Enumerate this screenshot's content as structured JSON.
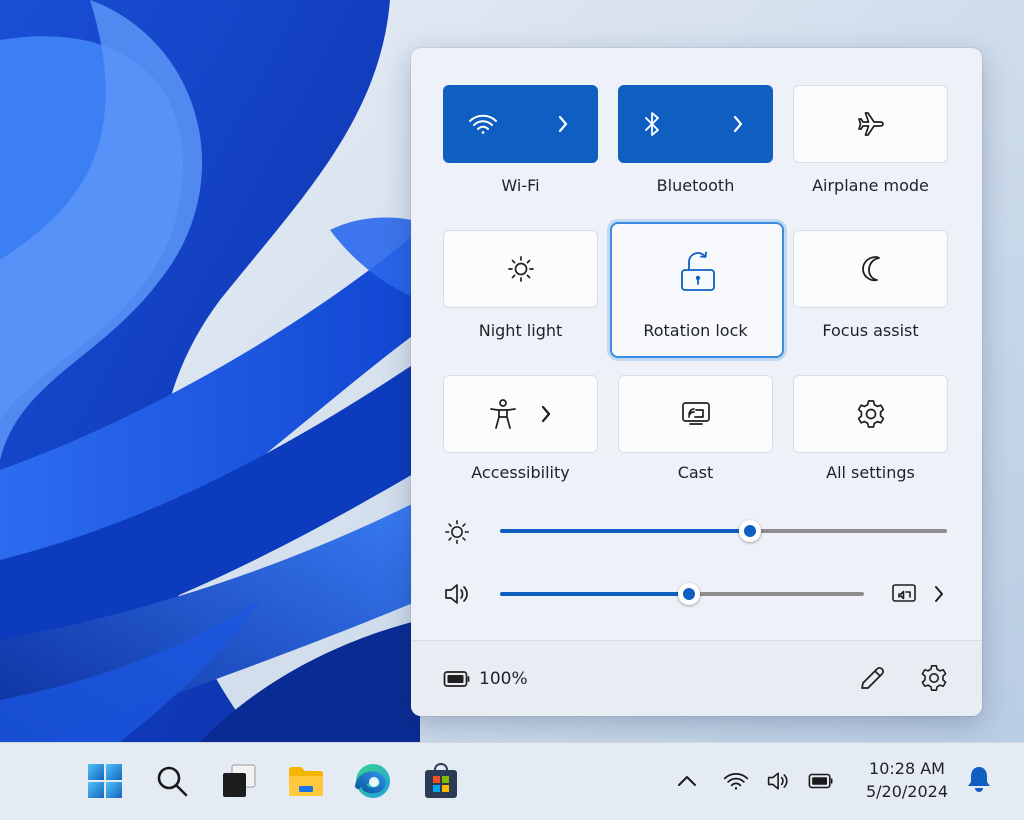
{
  "quick_settings": {
    "tiles": [
      {
        "label": "Wi-Fi",
        "icon": "wifi-icon",
        "state": "on",
        "has_chevron": true
      },
      {
        "label": "Bluetooth",
        "icon": "bluetooth-icon",
        "state": "on",
        "has_chevron": true
      },
      {
        "label": "Airplane mode",
        "icon": "airplane-icon",
        "state": "off",
        "has_chevron": false
      },
      {
        "label": "Night light",
        "icon": "sun-icon",
        "state": "off",
        "has_chevron": false
      },
      {
        "label": "Rotation lock",
        "icon": "unlocked-rotate-icon",
        "state": "focused",
        "has_chevron": false
      },
      {
        "label": "Focus assist",
        "icon": "moon-icon",
        "state": "off",
        "has_chevron": false
      },
      {
        "label": "Accessibility",
        "icon": "accessibility-icon",
        "state": "off",
        "has_chevron": true
      },
      {
        "label": "Cast",
        "icon": "cast-icon",
        "state": "off",
        "has_chevron": false
      },
      {
        "label": "All settings",
        "icon": "gear-icon",
        "state": "off",
        "has_chevron": false
      }
    ],
    "brightness": {
      "icon": "brightness-icon",
      "level": 0.56
    },
    "volume": {
      "icon": "speaker-icon",
      "level": 0.52,
      "output_icon": "audio-output-icon"
    },
    "battery": {
      "icon": "battery-icon",
      "text": "100%"
    },
    "footer_actions": [
      "edit-pencil-icon",
      "settings-gear-icon"
    ]
  },
  "taskbar": {
    "apps": [
      "windows-start-icon",
      "search-icon",
      "task-view-icon",
      "file-explorer-icon",
      "edge-icon",
      "store-icon"
    ],
    "tray": [
      "chevron-up-icon",
      "wifi-icon",
      "speaker-icon",
      "battery-icon"
    ],
    "time": "10:28 AM",
    "date": "5/20/2024",
    "notification_icon": "bell-icon"
  },
  "colors": {
    "accent": "#0f5fc2",
    "panel_bg": "#eef2f8",
    "taskbar_bg": "#e4ebf3"
  }
}
